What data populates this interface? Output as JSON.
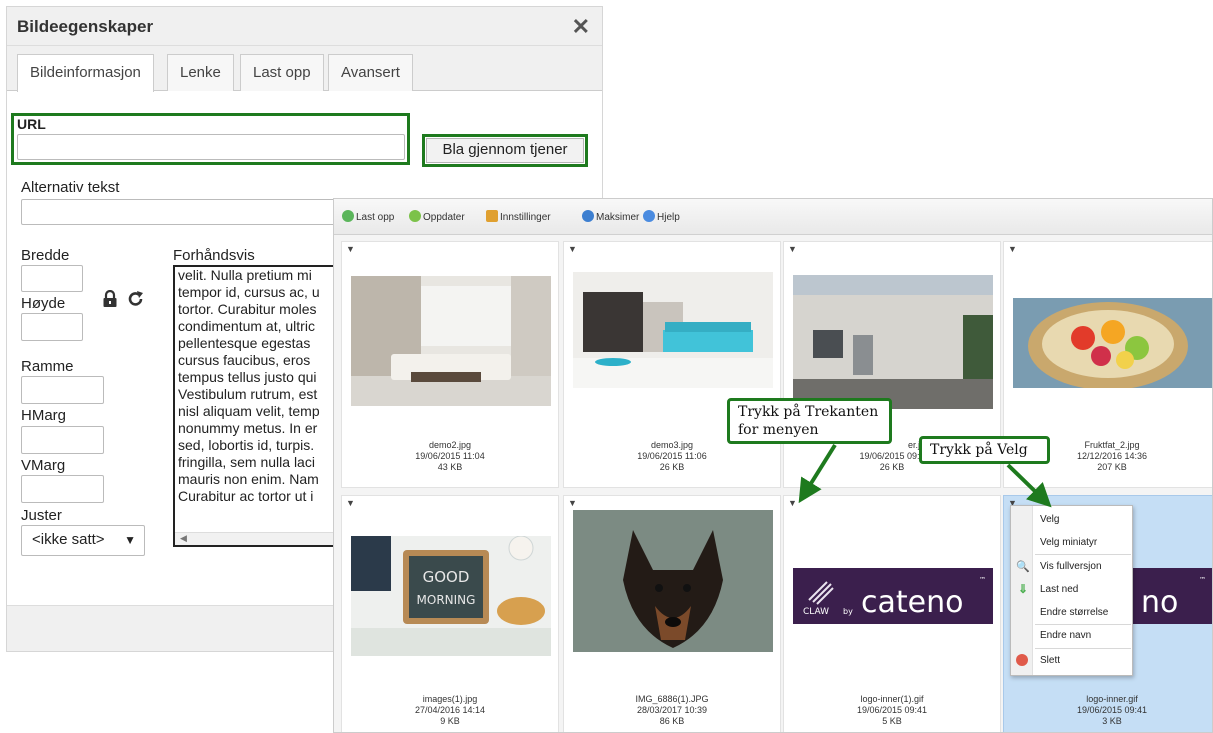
{
  "dialog": {
    "title": "Bildeegenskaper",
    "close_symbol": "✕",
    "tabs": [
      "Bildeinformasjon",
      "Lenke",
      "Last opp",
      "Avansert"
    ],
    "url_label": "URL",
    "browse_button": "Bla gjennom tjener",
    "alt_label": "Alternativ tekst",
    "width_label": "Bredde",
    "height_label": "Høyde",
    "border_label": "Ramme",
    "hspace_label": "HMarg",
    "vspace_label": "VMarg",
    "align_label": "Juster",
    "align_value": "<ikke satt>",
    "preview_label": "Forhåndsvis",
    "preview_lines": [
      "velit. Nulla pretium mi",
      "tempor id, cursus ac, u",
      "tortor. Curabitur moles",
      "condimentum at, ultric",
      "pellentesque egestas",
      "cursus faucibus, eros",
      "tempus tellus justo qui",
      "Vestibulum rutrum, est",
      "nisl aliquam velit, temp",
      "nonummy metus. In er",
      "sed, lobortis id, turpis.",
      "fringilla, sem nulla laci",
      "mauris non enim. Nam",
      "Curabitur ac tortor ut i"
    ]
  },
  "browser": {
    "toolbar": [
      "Last opp",
      "Oppdater",
      "Innstillinger",
      "Maksimer",
      "Hjelp"
    ],
    "files": [
      {
        "name": "demo2.jpg",
        "date": "19/06/2015 11:04",
        "size": "43 KB"
      },
      {
        "name": "demo3.jpg",
        "date": "19/06/2015 11:06",
        "size": "26 KB"
      },
      {
        "name": "er.jpg",
        "date": "19/06/2015 09:4",
        "size": "26 KB"
      },
      {
        "name": "Fruktfat_2.jpg",
        "date": "12/12/2016 14:36",
        "size": "207 KB"
      },
      {
        "name": "images(1).jpg",
        "date": "27/04/2016 14:14",
        "size": "9 KB"
      },
      {
        "name": "IMG_6886(1).JPG",
        "date": "28/03/2017 10:39",
        "size": "86 KB"
      },
      {
        "name": "logo-inner(1).gif",
        "date": "19/06/2015 09:41",
        "size": "5 KB"
      },
      {
        "name": "logo-inner.gif",
        "date": "19/06/2015 09:41",
        "size": "3 KB"
      }
    ],
    "chalk_text": [
      "GOOD",
      "MORNING"
    ],
    "logo": {
      "claw": "CLAW",
      "by": "by",
      "brand": "cateno",
      "tm": "™",
      "partial": "no"
    },
    "menu": [
      "Velg",
      "Velg miniatyr",
      "Vis fullversjon",
      "Last ned",
      "Endre størrelse",
      "Endre navn",
      "Slett"
    ]
  },
  "callouts": {
    "triangle": "Trykk på Trekanten\nfor menyen",
    "velg": "Trykk på Velg"
  },
  "colors": {
    "accent_green": "#1e7a1e",
    "selected_tile": "#c5def5",
    "logo_bg": "#3b1f4d"
  }
}
